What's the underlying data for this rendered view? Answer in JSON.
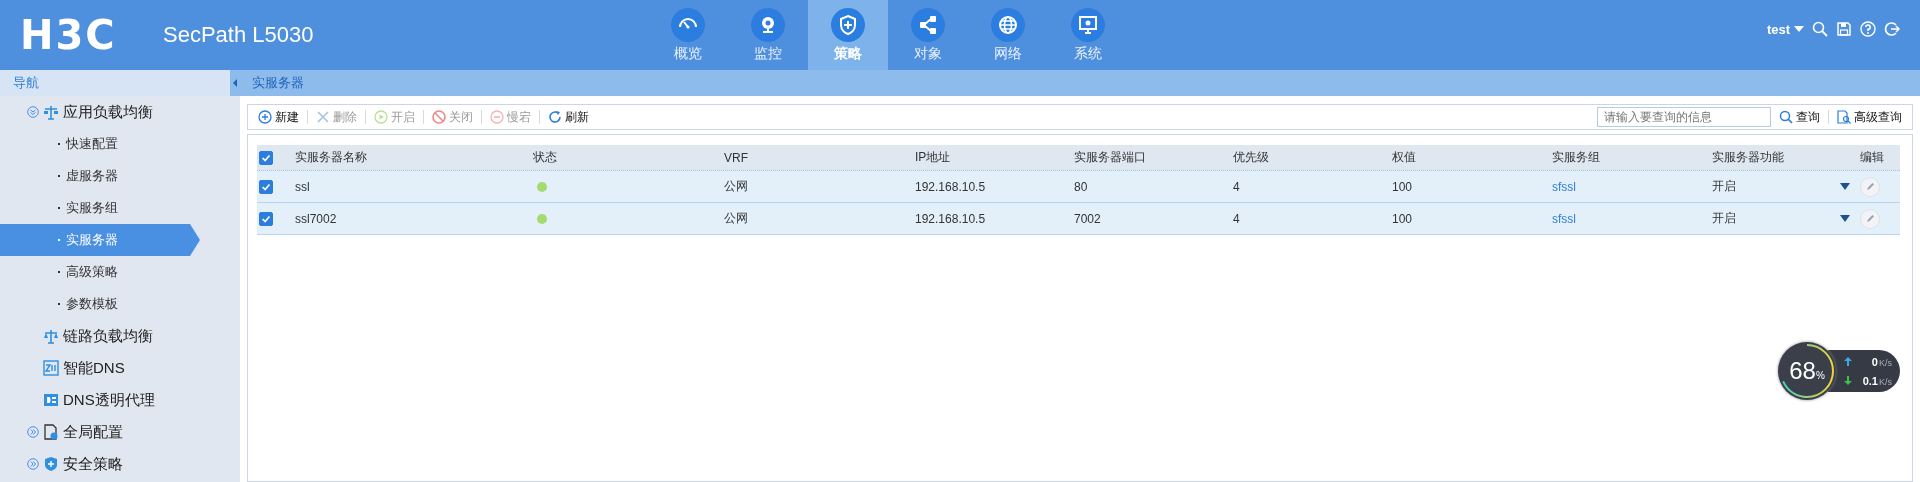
{
  "header": {
    "logo": "H3C",
    "product": "SecPath L5030",
    "nav": [
      {
        "label": "概览",
        "selected": false
      },
      {
        "label": "监控",
        "selected": false
      },
      {
        "label": "策略",
        "selected": true
      },
      {
        "label": "对象",
        "selected": false
      },
      {
        "label": "网络",
        "selected": false
      },
      {
        "label": "系统",
        "selected": false
      }
    ],
    "user": "test"
  },
  "sidebar": {
    "title": "导航",
    "items": [
      {
        "label": "应用负载均衡",
        "expanded": true,
        "selected": false,
        "children": [
          {
            "label": "快速配置",
            "selected": false
          },
          {
            "label": "虚服务器",
            "selected": false
          },
          {
            "label": "实服务组",
            "selected": false
          },
          {
            "label": "实服务器",
            "selected": true
          },
          {
            "label": "高级策略",
            "selected": false
          },
          {
            "label": "参数模板",
            "selected": false
          }
        ]
      },
      {
        "label": "链路负载均衡",
        "selected": false
      },
      {
        "label": "智能DNS",
        "selected": false
      },
      {
        "label": "DNS透明代理",
        "selected": false
      },
      {
        "label": "全局配置",
        "expanded": false,
        "selected": false
      },
      {
        "label": "安全策略",
        "expanded": false,
        "selected": false
      }
    ]
  },
  "breadcrumb": "实服务器",
  "toolbar": {
    "buttons": [
      {
        "label": "新建",
        "disabled": false
      },
      {
        "label": "删除",
        "disabled": true
      },
      {
        "label": "开启",
        "disabled": true
      },
      {
        "label": "关闭",
        "disabled": true
      },
      {
        "label": "慢宕",
        "disabled": true
      },
      {
        "label": "刷新",
        "disabled": false
      }
    ],
    "search": {
      "placeholder": "请输入要查询的信息"
    },
    "query": "查询",
    "advanced_query": "高级查询"
  },
  "table": {
    "select_all": true,
    "columns": [
      "实服务器名称",
      "状态",
      "VRF",
      "IP地址",
      "实服务器端口",
      "优先级",
      "权值",
      "实服务组",
      "实服务器功能",
      "编辑"
    ],
    "rows": [
      {
        "checked": true,
        "name": "ssl",
        "color": "#a3dc6e",
        "vrf": "公网",
        "ip": "192.168.10.5",
        "port": "80",
        "priority": "4",
        "weight": "100",
        "group": "sfssl",
        "function": "开启"
      },
      {
        "checked": true,
        "name": "ssl7002",
        "color": "#a3dc6e",
        "vrf": "公网",
        "ip": "192.168.10.5",
        "port": "7002",
        "priority": "4",
        "weight": "100",
        "group": "sfssl",
        "function": "开启"
      }
    ]
  },
  "monitor": {
    "value": "68",
    "unit": "%",
    "up": "0",
    "up_unit": "K/s",
    "down": "0.1",
    "down_unit": "K/s"
  }
}
